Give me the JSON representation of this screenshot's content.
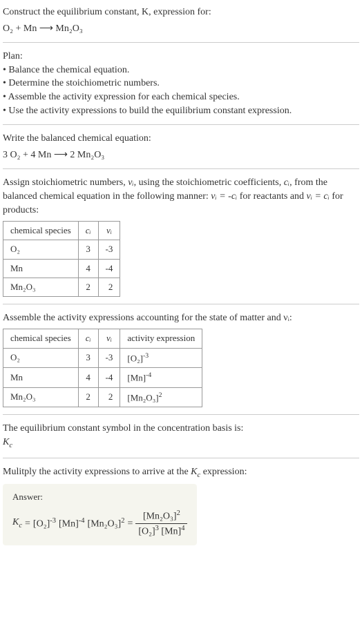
{
  "header": {
    "line1": "Construct the equilibrium constant, K, expression for:",
    "equation": "O₂ + Mn ⟶ Mn₂O₃"
  },
  "plan": {
    "title": "Plan:",
    "items": [
      "• Balance the chemical equation.",
      "• Determine the stoichiometric numbers.",
      "• Assemble the activity expression for each chemical species.",
      "• Use the activity expressions to build the equilibrium constant expression."
    ]
  },
  "balanced": {
    "title": "Write the balanced chemical equation:",
    "equation": "3 O₂ + 4 Mn ⟶ 2 Mn₂O₃"
  },
  "stoich": {
    "intro_part1": "Assign stoichiometric numbers, ",
    "intro_part2": ", using the stoichiometric coefficients, ",
    "intro_part3": ", from the balanced chemical equation in the following manner: ",
    "intro_part4": " for reactants and ",
    "intro_part5": " for products:",
    "nu_i": "νᵢ",
    "c_i": "cᵢ",
    "rel_reactants": "νᵢ = -cᵢ",
    "rel_products": "νᵢ = cᵢ",
    "headers": {
      "species": "chemical species",
      "ci": "cᵢ",
      "nui": "νᵢ"
    },
    "rows": [
      {
        "species": "O₂",
        "ci": "3",
        "nui": "-3"
      },
      {
        "species": "Mn",
        "ci": "4",
        "nui": "-4"
      },
      {
        "species": "Mn₂O₃",
        "ci": "2",
        "nui": "2"
      }
    ]
  },
  "activity": {
    "title": "Assemble the activity expressions accounting for the state of matter and νᵢ:",
    "headers": {
      "species": "chemical species",
      "ci": "cᵢ",
      "nui": "νᵢ",
      "activity": "activity expression"
    },
    "rows": [
      {
        "species": "O₂",
        "ci": "3",
        "nui": "-3",
        "activity_base": "[O₂]",
        "activity_exp": "-3"
      },
      {
        "species": "Mn",
        "ci": "4",
        "nui": "-4",
        "activity_base": "[Mn]",
        "activity_exp": "-4"
      },
      {
        "species": "Mn₂O₃",
        "ci": "2",
        "nui": "2",
        "activity_base": "[Mn₂O₃]",
        "activity_exp": "2"
      }
    ]
  },
  "kc_symbol": {
    "title": "The equilibrium constant symbol in the concentration basis is:",
    "symbol": "K",
    "sub": "c"
  },
  "multiply": {
    "title": "Mulitply the activity expressions to arrive at the Kc expression:"
  },
  "answer": {
    "label": "Answer:",
    "kc": "K",
    "kc_sub": "c",
    "eq": " = ",
    "term1_base": "[O₂]",
    "term1_exp": "-3",
    "term2_base": "[Mn]",
    "term2_exp": "-4",
    "term3_base": "[Mn₂O₃]",
    "term3_exp": "2",
    "num_base": "[Mn₂O₃]",
    "num_exp": "2",
    "den1_base": "[O₂]",
    "den1_exp": "3",
    "den2_base": "[Mn]",
    "den2_exp": "4"
  }
}
